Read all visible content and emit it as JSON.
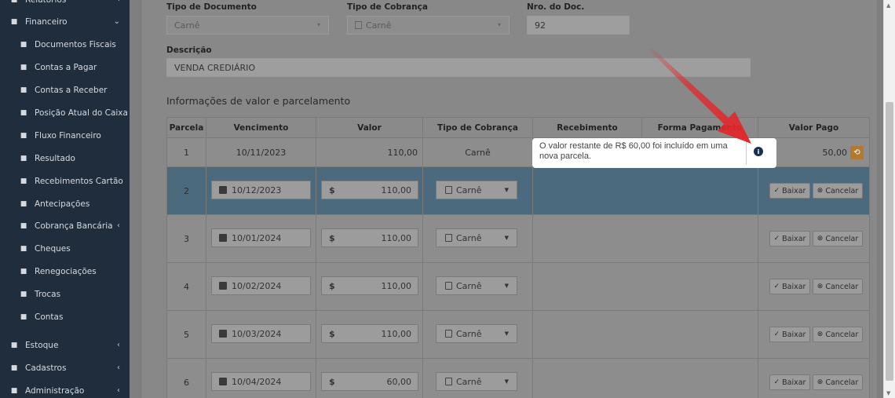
{
  "sidebar": {
    "items": [
      {
        "label": "Relatórios",
        "icon": "report-icon",
        "level": "top",
        "chevron": true
      },
      {
        "label": "Financeiro",
        "icon": "money-icon",
        "level": "top",
        "chevron": true,
        "expanded": true
      },
      {
        "label": "Documentos Fiscais",
        "icon": "document-icon",
        "level": "sub"
      },
      {
        "label": "Contas a Pagar",
        "icon": "file-icon",
        "level": "sub"
      },
      {
        "label": "Contas a Receber",
        "icon": "line-chart-icon",
        "level": "sub"
      },
      {
        "label": "Posição Atual do Caixa",
        "icon": "dollar-icon",
        "level": "sub"
      },
      {
        "label": "Fluxo Financeiro",
        "icon": "area-chart-icon",
        "level": "sub"
      },
      {
        "label": "Resultado",
        "icon": "pie-chart-icon",
        "level": "sub"
      },
      {
        "label": "Recebimentos Cartão",
        "icon": "credit-card-icon",
        "level": "sub"
      },
      {
        "label": "Antecipações",
        "icon": "calendar-icon",
        "level": "sub"
      },
      {
        "label": "Cobrança Bancária",
        "icon": "barcode-icon",
        "level": "sub",
        "chevron": true
      },
      {
        "label": "Cheques",
        "icon": "edit-icon",
        "level": "sub"
      },
      {
        "label": "Renegociações",
        "icon": "handshake-icon",
        "level": "sub"
      },
      {
        "label": "Trocas",
        "icon": "refresh-icon",
        "level": "sub"
      },
      {
        "label": "Contas",
        "icon": "bank-icon",
        "level": "sub"
      },
      {
        "label": "Estoque",
        "icon": "exchange-icon",
        "level": "top",
        "chevron": true
      },
      {
        "label": "Cadastros",
        "icon": "pencil-icon",
        "level": "top",
        "chevron": true
      },
      {
        "label": "Administração",
        "icon": "cogs-icon",
        "level": "top",
        "chevron": true
      }
    ]
  },
  "form": {
    "tipo_documento": {
      "label": "Tipo de Documento",
      "value": "Carnê"
    },
    "tipo_cobranca": {
      "label": "Tipo de Cobrança",
      "value": "Carnê"
    },
    "nro_doc": {
      "label": "Nro. do Doc.",
      "value": "92"
    },
    "descricao": {
      "label": "Descrição",
      "value": "VENDA CREDIÁRIO"
    }
  },
  "section_title": "Informações de valor e parcelamento",
  "table": {
    "headers": [
      "Parcela",
      "Vencimento",
      "Valor",
      "Tipo de Cobrança",
      "Recebimento",
      "Forma Pagamento",
      "Valor Pago"
    ],
    "first_row": {
      "parcela": "1",
      "vencimento": "10/11/2023",
      "valor": "110,00",
      "tipo": "Carnê",
      "valor_pago": "50,00"
    },
    "rows": [
      {
        "parcela": "2",
        "vencimento": "10/12/2023",
        "valor": "110,00",
        "tipo": "Carnê"
      },
      {
        "parcela": "3",
        "vencimento": "10/01/2024",
        "valor": "110,00",
        "tipo": "Carnê"
      },
      {
        "parcela": "4",
        "vencimento": "10/02/2024",
        "valor": "110,00",
        "tipo": "Carnê"
      },
      {
        "parcela": "5",
        "vencimento": "10/03/2024",
        "valor": "110,00",
        "tipo": "Carnê"
      },
      {
        "parcela": "6",
        "vencimento": "10/04/2024",
        "valor": "60,00",
        "tipo": "Carnê"
      }
    ],
    "baixar_label": "Baixar",
    "cancelar_label": "Cancelar",
    "currency_symbol": "$"
  },
  "tooltip": {
    "text": "O valor restante de R$ 60,00 foi incluído em uma nova parcela."
  },
  "colors": {
    "sidebar_bg": "#1f2d3d",
    "selected_row": "#4b6a7e",
    "arrow": "#e3262b",
    "undo_button": "#b07a30"
  }
}
